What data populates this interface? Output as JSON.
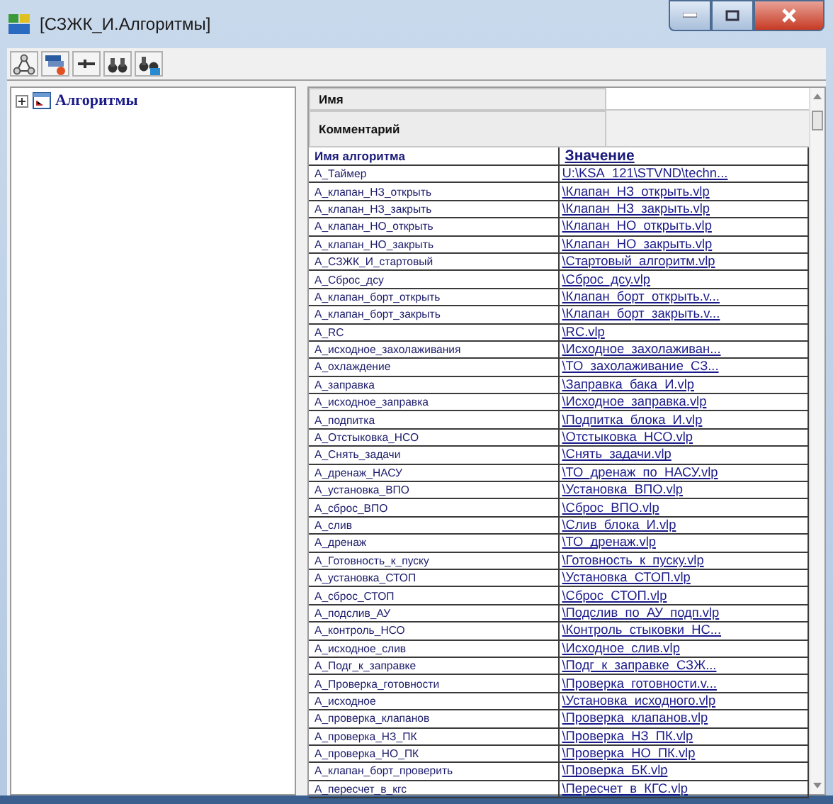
{
  "window": {
    "title": "[СЗЖК_И.Алгоритмы]"
  },
  "tree": {
    "items": [
      {
        "label": "Алгоритмы",
        "expanded": false
      }
    ]
  },
  "properties": [
    {
      "label": "Имя"
    },
    {
      "label": "Комментарий"
    }
  ],
  "table": {
    "columns": [
      "Имя алгоритма",
      "Значение"
    ],
    "rows": [
      [
        "А_Таймер",
        "U:\\KSA_121\\STVND\\techn..."
      ],
      [
        "А_клапан_НЗ_открыть",
        "\\Клапан_НЗ_открыть.vlp"
      ],
      [
        "А_клапан_НЗ_закрыть",
        "\\Клапан_НЗ_закрыть.vlp"
      ],
      [
        "А_клапан_НО_открыть",
        "\\Клапан_НО_открыть.vlp"
      ],
      [
        "А_клапан_НО_закрыть",
        "\\Клапан_НО_закрыть.vlp"
      ],
      [
        "А_СЗЖК_И_стартовый",
        "\\Стартовый_алгоритм.vlp"
      ],
      [
        "А_Сброс_дсу",
        "\\Сброс_дсу.vlp"
      ],
      [
        "А_клапан_борт_открыть",
        "\\Клапан_борт_открыть.v..."
      ],
      [
        "А_клапан_борт_закрыть",
        "\\Клапан_борт_закрыть.v..."
      ],
      [
        "А_RC",
        "\\RC.vlp"
      ],
      [
        "А_исходное_захолаживания",
        "\\Исходное_захолаживан..."
      ],
      [
        "А_охлаждение",
        "\\ТО_захолаживание_СЗ..."
      ],
      [
        "А_заправка",
        "\\Заправка_бака_И.vlp"
      ],
      [
        "А_исходное_заправка",
        "\\Исходное_заправка.vlp"
      ],
      [
        "А_подпитка",
        "\\Подпитка_блока_И.vlp"
      ],
      [
        "А_Отстыковка_НСО",
        "\\Отстыковка_НСО.vlp"
      ],
      [
        "А_Снять_задачи",
        "\\Снять_задачи.vlp"
      ],
      [
        "А_дренаж_НАСУ",
        "\\ТО_дренаж_по_НАСУ.vlp"
      ],
      [
        "А_установка_ВПО",
        "\\Установка_ВПО.vlp"
      ],
      [
        "А_сброс_ВПО",
        "\\Сброс_ВПО.vlp"
      ],
      [
        "А_слив",
        "\\Слив_блока_И.vlp"
      ],
      [
        "А_дренаж",
        "\\ТО_дренаж.vlp"
      ],
      [
        "А_Готовность_к_пуску",
        "\\Готовность_к_пуску.vlp"
      ],
      [
        "А_установка_СТОП",
        "\\Установка_СТОП.vlp"
      ],
      [
        "А_сброс_СТОП",
        "\\Сброс_СТОП.vlp"
      ],
      [
        "А_подслив_АУ",
        "\\Подслив_по_АУ_подп.vlp"
      ],
      [
        "А_контроль_НСО",
        "\\Контроль_стыковки_НС..."
      ],
      [
        "А_исходное_слив",
        "\\Исходное_слив.vlp"
      ],
      [
        "А_Подг_к_заправке",
        "\\Подг_к_заправке_СЗЖ..."
      ],
      [
        "А_Проверка_готовности",
        "\\Проверка_готовности.v..."
      ],
      [
        "А_исходное",
        "\\Установка_исходного.vlp"
      ],
      [
        "А_проверка_клапанов",
        "\\Проверка_клапанов.vlp"
      ],
      [
        "А_проверка_НЗ_ПК",
        "\\Проверка_НЗ_ПК.vlp"
      ],
      [
        "А_проверка_НО_ПК",
        "\\Проверка_НО_ПК.vlp"
      ],
      [
        "А_клапан_борт_проверить",
        "\\Проверка_БК.vlp"
      ],
      [
        "А_пересчет_в_кгс",
        "\\Пересчет_в_КГС.vlp"
      ]
    ]
  }
}
